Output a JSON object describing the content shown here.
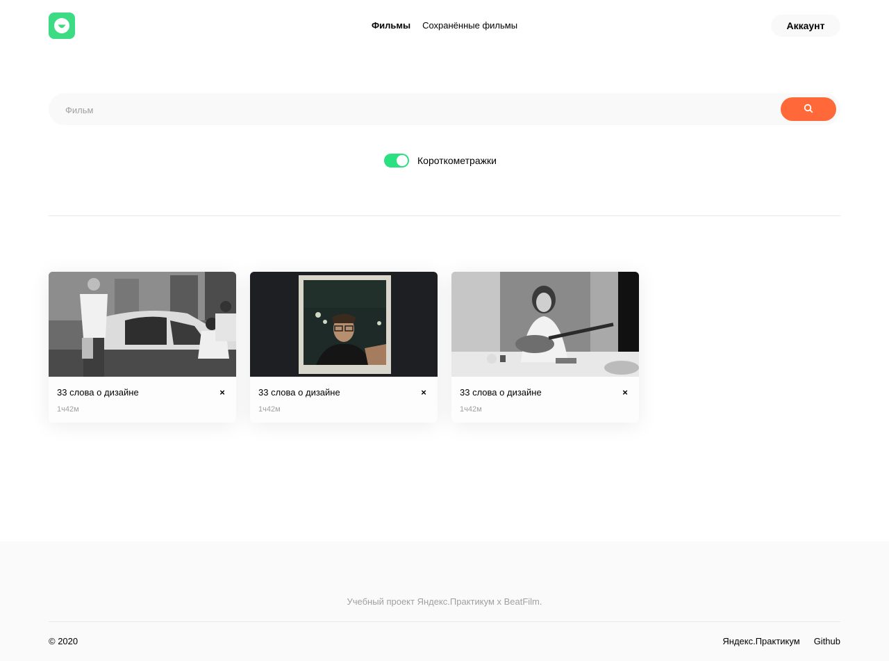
{
  "header": {
    "logo_icon": "smile-logo-icon",
    "nav": [
      "Фильмы",
      "Сохранённые фильмы"
    ],
    "account_label": "Аккаунт"
  },
  "search": {
    "placeholder": "Фильм",
    "value": "",
    "button_icon": "search-icon"
  },
  "filter": {
    "label": "Короткометражки",
    "enabled": true
  },
  "cards": [
    {
      "title": "33 слова о дизайне",
      "duration": "1ч42м",
      "remove": "×",
      "image": "bw-street-photographer-with-car"
    },
    {
      "title": "33 слова о дизайне",
      "duration": "1ч42м",
      "remove": "×",
      "image": "polaroid-portrait-man-in-glasses"
    },
    {
      "title": "33 слова о дизайне",
      "duration": "1ч42м",
      "remove": "×",
      "image": "bw-man-playing-guitar-at-table"
    }
  ],
  "footer": {
    "project": "Учебный проект Яндекс.Практикум х BeatFilm.",
    "copyright": "© 2020",
    "links": [
      "Яндекс.Практикум",
      "Github"
    ]
  },
  "colors": {
    "accent_green": "#3ddc84",
    "toggle_green": "#2be080",
    "search_orange": "#ff6838",
    "light_gray_bg": "#f9f9f9",
    "muted_text": "#a0a0a0"
  }
}
